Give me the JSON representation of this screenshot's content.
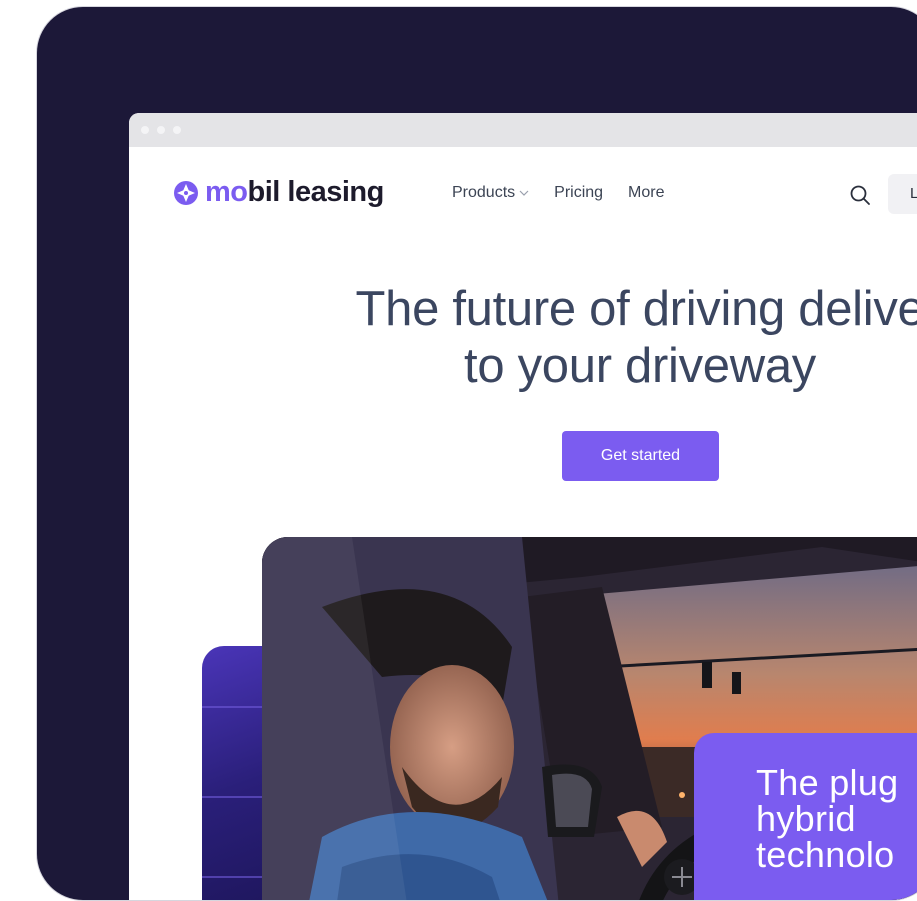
{
  "brand": {
    "prefix": "mo",
    "rest": "bil leasing"
  },
  "nav": {
    "items": [
      {
        "label": "Products",
        "has_dropdown": true
      },
      {
        "label": "Pricing",
        "has_dropdown": false
      },
      {
        "label": "More",
        "has_dropdown": false
      }
    ],
    "search_icon": "search-icon",
    "login_label": "L"
  },
  "hero": {
    "title_line1": "The future of driving delive",
    "title_line2": "to your driveway",
    "cta_label": "Get started"
  },
  "promo": {
    "line1": "The plug",
    "line2": "hybrid",
    "line3": "technolo"
  },
  "colors": {
    "frame_bg": "#1c1838",
    "accent": "#7b5cf0",
    "heading": "#3b4660",
    "nav_text": "#3c4454"
  }
}
